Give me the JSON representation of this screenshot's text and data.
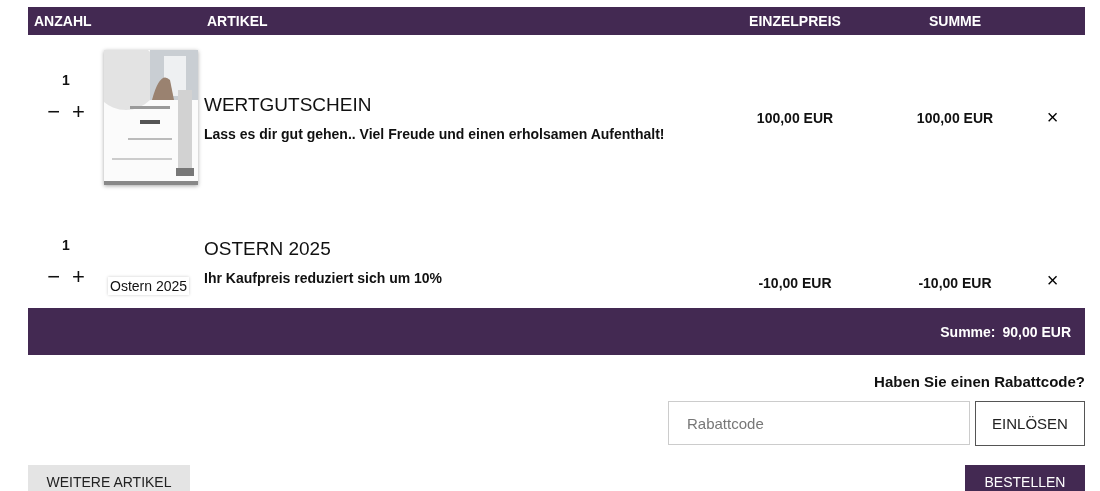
{
  "columns": [
    "ANZAHL",
    "ARTIKEL",
    "EINZELPREIS",
    "SUMME"
  ],
  "items": [
    {
      "kind": "picture",
      "quantity": "1",
      "decrease": "−",
      "increase": "+",
      "title": "WERTGUTSCHEIN",
      "description": "Lass es dir gut gehen.. Viel Freude und einen erholsamen Aufenthalt!",
      "unit_price": "100,00 EUR",
      "total": "100,00 EUR",
      "remove": "×"
    },
    {
      "kind": "label",
      "image_label": "Ostern 2025",
      "quantity": "1",
      "decrease": "−",
      "increase": "+",
      "title": "OSTERN 2025",
      "description": "Ihr Kaufpreis reduziert sich um 10%",
      "unit_price": "-10,00 EUR",
      "total": "-10,00 EUR",
      "remove": "×"
    }
  ],
  "total": {
    "label": "Summe:",
    "value": "90,00 EUR"
  },
  "coupon": {
    "question": "Haben Sie einen Rabattcode?",
    "placeholder": "Rabattcode",
    "button": "EINLÖSEN"
  },
  "buttons": {
    "continue": "WEITERE ARTIKEL",
    "order": "BESTELLEN"
  }
}
